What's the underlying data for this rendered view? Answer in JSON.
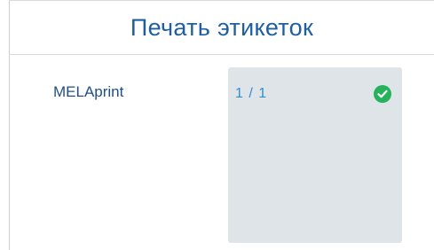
{
  "header": {
    "title": "Печать этикеток"
  },
  "printer": {
    "name": "MELAprint",
    "count": "1 / 1",
    "status_icon": "check-circle-icon",
    "status_color": "#26b25a",
    "card_color": "#dfe4e9"
  }
}
